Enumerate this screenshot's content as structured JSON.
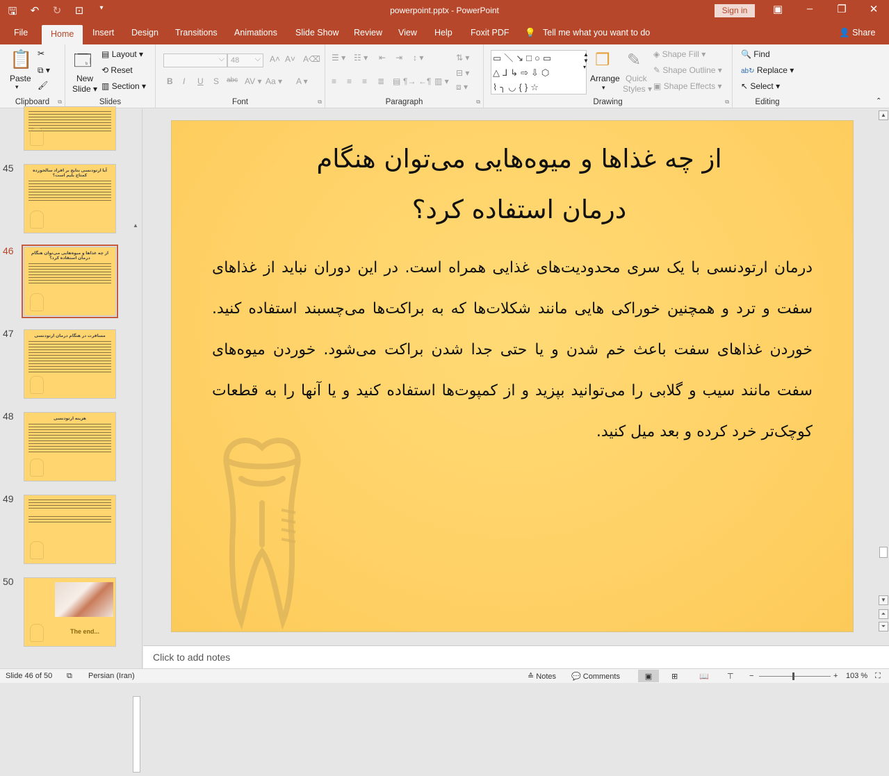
{
  "window": {
    "title": "powerpoint.pptx - PowerPoint",
    "sign_in": "Sign in"
  },
  "tabs": [
    "File",
    "Home",
    "Insert",
    "Design",
    "Transitions",
    "Animations",
    "Slide Show",
    "Review",
    "View",
    "Help",
    "Foxit PDF"
  ],
  "tell_me": "Tell me what you want to do",
  "share": "Share",
  "ribbon": {
    "clipboard": {
      "label": "Clipboard",
      "paste": "Paste"
    },
    "slides": {
      "label": "Slides",
      "new_slide_line1": "New",
      "new_slide_line2": "Slide",
      "layout": "Layout",
      "reset": "Reset",
      "section": "Section"
    },
    "font": {
      "label": "Font",
      "size": "48"
    },
    "paragraph": {
      "label": "Paragraph"
    },
    "drawing": {
      "label": "Drawing",
      "arrange": "Arrange",
      "quick_styles_1": "Quick",
      "quick_styles_2": "Styles",
      "shape_fill": "Shape Fill",
      "shape_outline": "Shape Outline",
      "shape_effects": "Shape Effects"
    },
    "editing": {
      "label": "Editing",
      "find": "Find",
      "replace": "Replace",
      "select": "Select"
    }
  },
  "thumbnails": [
    {
      "num": "45",
      "title": "آیا ارتودنسی نتایج بر افراد سالخورده کمتاج بلیم است؟"
    },
    {
      "num": "46",
      "title": "از چه غذاها و میوه‌هایی می‌توان هنگام درمان استفاده کرد؟"
    },
    {
      "num": "47",
      "title": "مسافرت در هنگام درمان ارتودنسی"
    },
    {
      "num": "48",
      "title": "هزینه ارتودنسی"
    },
    {
      "num": "49",
      "title": ""
    },
    {
      "num": "50",
      "title": "The end..."
    }
  ],
  "slide": {
    "title_line1": "از چه غذاها و میوه‌هایی می‌توان هنگام",
    "title_line2": "درمان استفاده کرد؟",
    "body": "درمان ارتودنسی با یک سری محدودیت‌های غذایی همراه است. در این دوران نباید از غذاهای سفت و ترد و همچنین خوراکی هایی مانند شکلات‌ها که به براکت‌ها می‌چسبند استفاده کنید. خوردن غذاهای سفت باعث خم شدن و یا حتی جدا شدن براکت می‌شود. خوردن میوه‌های سفت مانند سیب و گلابی را می‌توانید بپزید و از کمپوت‌ها استفاده کنید و یا آنها را به قطعات کوچک‌تر خرد کرده و بعد میل کنید."
  },
  "notes_placeholder": "Click to add notes",
  "status": {
    "slide_of": "Slide 46 of 50",
    "language": "Persian (Iran)",
    "notes": "Notes",
    "comments": "Comments",
    "zoom": "103 %"
  }
}
